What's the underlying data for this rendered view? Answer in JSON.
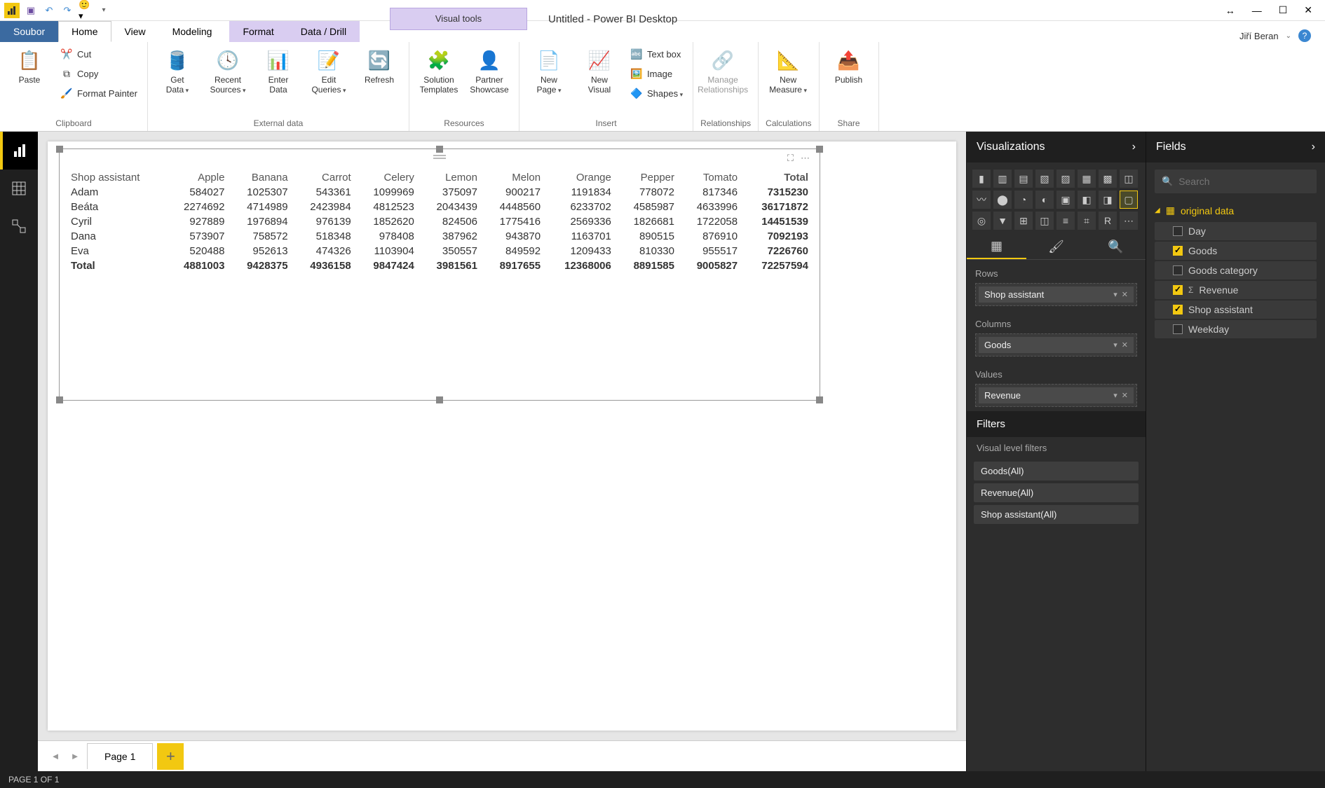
{
  "titlebar": {
    "doc_title": "Untitled - Power BI Desktop",
    "visual_tools": "Visual tools",
    "qat": {
      "save": "💾",
      "undo": "↶",
      "redo": "↷",
      "smiley": "🙂"
    }
  },
  "menus": {
    "file": "Soubor",
    "home": "Home",
    "view": "View",
    "modeling": "Modeling",
    "format": "Format",
    "data_drill": "Data / Drill"
  },
  "user": {
    "name": "Jiří Beran"
  },
  "ribbon": {
    "clipboard": {
      "label": "Clipboard",
      "paste": "Paste",
      "cut": "Cut",
      "copy": "Copy",
      "format_painter": "Format Painter"
    },
    "external": {
      "label": "External data",
      "get_data": "Get\nData",
      "recent": "Recent\nSources",
      "enter": "Enter\nData",
      "edit": "Edit\nQueries",
      "refresh": "Refresh"
    },
    "resources": {
      "label": "Resources",
      "solution": "Solution\nTemplates",
      "partner": "Partner\nShowcase"
    },
    "insert": {
      "label": "Insert",
      "new_page": "New\nPage",
      "new_visual": "New\nVisual",
      "text_box": "Text box",
      "image": "Image",
      "shapes": "Shapes"
    },
    "relationships": {
      "label": "Relationships",
      "manage": "Manage\nRelationships"
    },
    "calculations": {
      "label": "Calculations",
      "measure": "New\nMeasure"
    },
    "share": {
      "label": "Share",
      "publish": "Publish"
    }
  },
  "leftrail": {
    "report": "Report",
    "data": "Data",
    "model": "Model"
  },
  "matrix": {
    "row_header": "Shop assistant",
    "columns": [
      "Apple",
      "Banana",
      "Carrot",
      "Celery",
      "Lemon",
      "Melon",
      "Orange",
      "Pepper",
      "Tomato",
      "Total"
    ],
    "rows": [
      {
        "name": "Adam",
        "v": [
          584027,
          1025307,
          543361,
          1099969,
          375097,
          900217,
          1191834,
          778072,
          817346,
          7315230
        ]
      },
      {
        "name": "Beáta",
        "v": [
          2274692,
          4714989,
          2423984,
          4812523,
          2043439,
          4448560,
          6233702,
          4585987,
          4633996,
          36171872
        ]
      },
      {
        "name": "Cyril",
        "v": [
          927889,
          1976894,
          976139,
          1852620,
          824506,
          1775416,
          2569336,
          1826681,
          1722058,
          14451539
        ]
      },
      {
        "name": "Dana",
        "v": [
          573907,
          758572,
          518348,
          978408,
          387962,
          943870,
          1163701,
          890515,
          876910,
          7092193
        ]
      },
      {
        "name": "Eva",
        "v": [
          520488,
          952613,
          474326,
          1103904,
          350557,
          849592,
          1209433,
          810330,
          955517,
          7226760
        ]
      }
    ],
    "total_label": "Total",
    "totals": [
      4881003,
      9428375,
      4936158,
      9847424,
      3981561,
      8917655,
      12368006,
      8891585,
      9005827,
      72257594
    ]
  },
  "pages": {
    "page1": "Page 1"
  },
  "status": "PAGE 1 OF 1",
  "viz_pane": {
    "header": "Visualizations",
    "rows_label": "Rows",
    "rows_item": "Shop assistant",
    "cols_label": "Columns",
    "cols_item": "Goods",
    "vals_label": "Values",
    "vals_item": "Revenue",
    "filters_header": "Filters",
    "filters_sub": "Visual level filters",
    "filter_items": [
      "Goods(All)",
      "Revenue(All)",
      "Shop assistant(All)"
    ]
  },
  "fields_pane": {
    "header": "Fields",
    "search_placeholder": "Search",
    "table_name": "original data",
    "fields": [
      {
        "name": "Day",
        "checked": false,
        "sigma": false
      },
      {
        "name": "Goods",
        "checked": true,
        "sigma": false
      },
      {
        "name": "Goods category",
        "checked": false,
        "sigma": false
      },
      {
        "name": "Revenue",
        "checked": true,
        "sigma": true
      },
      {
        "name": "Shop assistant",
        "checked": true,
        "sigma": false
      },
      {
        "name": "Weekday",
        "checked": false,
        "sigma": false
      }
    ]
  }
}
